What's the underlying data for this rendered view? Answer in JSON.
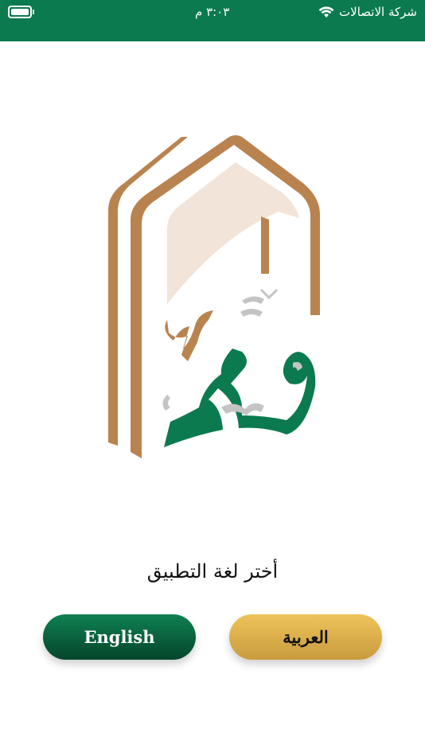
{
  "status_bar": {
    "carrier": "شركة الاتصالات",
    "time": "٣:٠٣ م",
    "wifi_icon": "wifi-icon",
    "battery_icon": "battery-icon",
    "battery_level": 1.0,
    "background": "#0b7a4f"
  },
  "logo": {
    "icon": "nasir-logo",
    "colors": {
      "arch": "#b98350",
      "arch_inner": "#f2e4d8",
      "calligraphy": "#0b7a4f",
      "diacritics": "#c4c4c4"
    }
  },
  "language_select": {
    "prompt": "أختر لغة التطبيق",
    "english_label": "English",
    "arabic_label": "العربية",
    "english_colors": [
      "#0f8050",
      "#05452b"
    ],
    "arabic_colors": [
      "#efc35a",
      "#c99b3f"
    ]
  }
}
